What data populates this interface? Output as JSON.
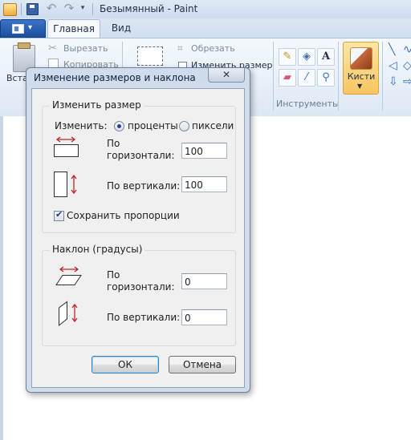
{
  "window": {
    "title": "Безымянный - Paint"
  },
  "ribbon": {
    "tabs": [
      {
        "label": "Главная",
        "active": true
      },
      {
        "label": "Вид",
        "active": false
      }
    ],
    "clipboard": {
      "paste_label": "Вста",
      "cut_label": "Вырезать",
      "copy_label": "Копировать"
    },
    "image": {
      "crop_label": "Обрезать",
      "resize_label": "Изменить размер"
    },
    "tools_group_label": "Инструменты",
    "brushes_label": "Кисти",
    "icons": [
      "pencil-icon",
      "fill-bucket-icon",
      "text-icon",
      "eraser-icon",
      "color-picker-icon",
      "magnifier-icon",
      "brush-icon"
    ]
  },
  "dialog": {
    "title": "Изменение размеров и наклона",
    "close_glyph": "✕",
    "resize": {
      "group_title": "Изменить размер",
      "by_label": "Изменить:",
      "options": [
        {
          "label": "проценты",
          "selected": true
        },
        {
          "label": "пиксели",
          "selected": false
        }
      ],
      "horizontal_label_1": "По",
      "horizontal_label_2": "горизонтали:",
      "horizontal_value": "100",
      "vertical_label": "По вертикали:",
      "vertical_value": "100",
      "keep_ratio_label": "Сохранить пропорции",
      "keep_ratio_checked": true
    },
    "skew": {
      "group_title": "Наклон (градусы)",
      "horizontal_label_1": "По",
      "horizontal_label_2": "горизонтали:",
      "horizontal_value": "0",
      "vertical_label": "По вертикали:",
      "vertical_value": "0"
    },
    "ok_label": "ОК",
    "cancel_label": "Отмена"
  },
  "colors": {
    "arrow_red": "#c0262c",
    "accent_blue": "#1e4b86"
  }
}
